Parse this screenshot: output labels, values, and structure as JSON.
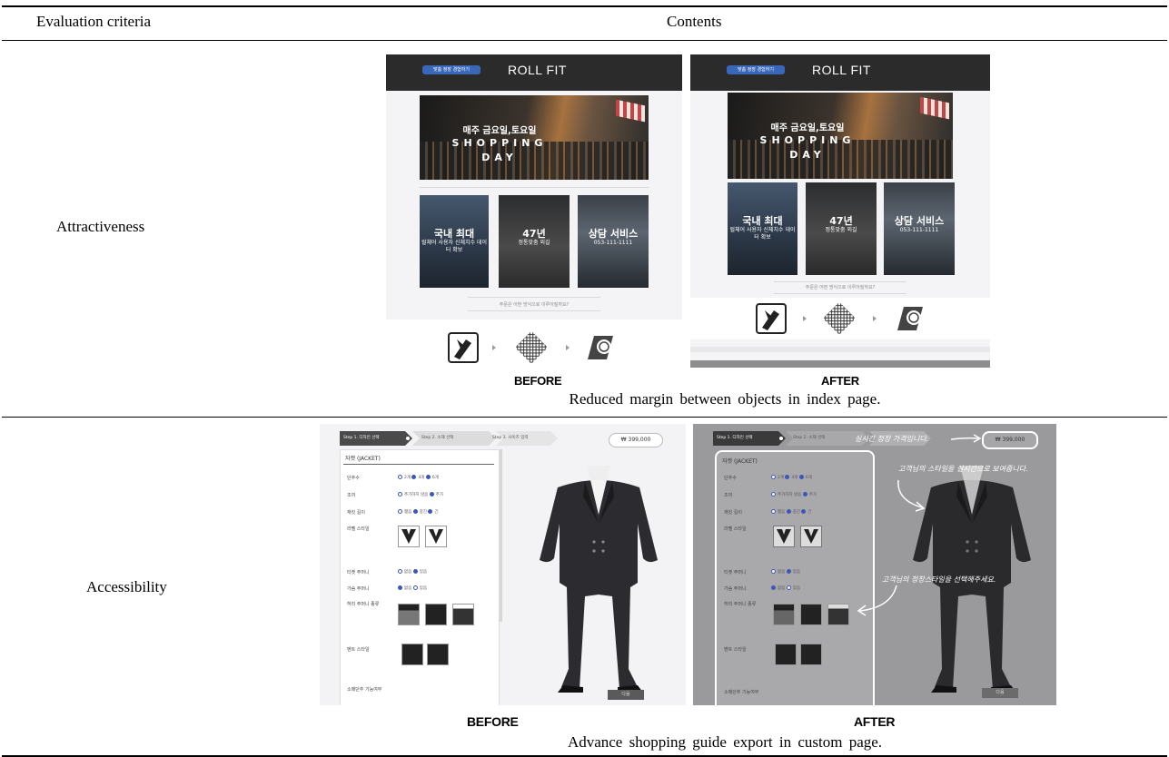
{
  "table": {
    "header": {
      "criteria": "Evaluation criteria",
      "contents": "Contents"
    },
    "rows": [
      {
        "criteria": "Attractiveness",
        "before_label": "BEFORE",
        "after_label": "AFTER",
        "caption": "Reduced margin between objects in index page."
      },
      {
        "criteria": "Accessibility",
        "before_label": "BEFORE",
        "after_label": "AFTER",
        "caption": "Advance shopping guide export in custom page."
      }
    ]
  },
  "index_page": {
    "logo": "ROLL FIT",
    "cta": "맞춤 정장 경험하기",
    "banner": {
      "line1": "매주 금요일,토요일",
      "line2": "SHOPPING",
      "line3": "DAY"
    },
    "tiles": [
      {
        "title": "국내 최대",
        "sub": "럴체어 사용자 신체치수 데이터 확보"
      },
      {
        "title": "47년",
        "sub": "정통맞춤 외길"
      },
      {
        "title": "상담 서비스",
        "sub": "053-111-1111"
      }
    ],
    "question": "주문은 어떤 방식으로 이루어질까요?"
  },
  "custom_page": {
    "steps": [
      "Step 1. 디자인 선택",
      "Step 2. 소재 선택",
      "Step 3. 사이즈 입력"
    ],
    "price": "₩ 399,000",
    "section_title": "자켓 (JACKET)",
    "rows": [
      "단추수",
      "조끼",
      "재킷 길이",
      "라펠 스타일",
      "티켓 주머니",
      "가슴 주머니",
      "허리 주머니 종류",
      "벤트 스타일",
      "소매단추 기능여부"
    ],
    "next": "다음",
    "notes": [
      "실시간 정장 가격입니다.",
      "고객님의 스타일을 실시간으로 보여줍니다.",
      "고객님의 정장스타일을 선택해주세요."
    ]
  }
}
